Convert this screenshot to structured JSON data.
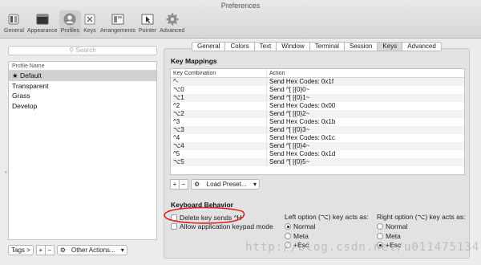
{
  "window": {
    "title": "Preferences"
  },
  "toolbar": {
    "items": [
      {
        "label": "General",
        "icon": "switch-icon"
      },
      {
        "label": "Appearance",
        "icon": "window-icon"
      },
      {
        "label": "Profiles",
        "icon": "person-icon"
      },
      {
        "label": "Keys",
        "icon": "keys-icon"
      },
      {
        "label": "Arrangements",
        "icon": "arrangements-icon"
      },
      {
        "label": "Pointer",
        "icon": "pointer-icon"
      },
      {
        "label": "Advanced",
        "icon": "gear-icon"
      }
    ],
    "active": "Profiles"
  },
  "search": {
    "placeholder": "Search"
  },
  "profile_list": {
    "header": "Profile Name",
    "rows": [
      "★ Default",
      "Transparent",
      "Grass",
      "Develop"
    ]
  },
  "bottom": {
    "tags_label": "Tags >",
    "plus": "+",
    "minus": "−",
    "other_actions": "Other Actions..."
  },
  "tabs": {
    "items": [
      "General",
      "Colors",
      "Text",
      "Window",
      "Terminal",
      "Session",
      "Keys",
      "Advanced"
    ],
    "active": "Keys"
  },
  "key_mappings": {
    "title": "Key Mappings",
    "columns": [
      "Key Combination",
      "Action"
    ],
    "rows": [
      [
        "^-",
        "Send Hex Codes: 0x1f"
      ],
      [
        "⌥0",
        "Send ^[ [{0}0~"
      ],
      [
        "⌥1",
        "Send ^[ [{0}1~"
      ],
      [
        "^2",
        "Send Hex Codes: 0x00"
      ],
      [
        "⌥2",
        "Send ^[ [{0}2~"
      ],
      [
        "^3",
        "Send Hex Codes: 0x1b"
      ],
      [
        "⌥3",
        "Send ^[ [{0}3~"
      ],
      [
        "^4",
        "Send Hex Codes: 0x1c"
      ],
      [
        "⌥4",
        "Send ^[ [{0}4~"
      ],
      [
        "^5",
        "Send Hex Codes: 0x1d"
      ],
      [
        "⌥5",
        "Send ^[ [{0}5~"
      ]
    ],
    "plus": "+",
    "minus": "−",
    "load_preset": "Load Preset..."
  },
  "keyboard_behavior": {
    "title": "Keyboard Behavior",
    "delete_sends_h": "Delete key sends ^H",
    "keypad_mode": "Allow application keypad mode",
    "left_option": {
      "label": "Left option (⌥) key acts as:",
      "options": [
        "Normal",
        "Meta",
        "+Esc"
      ],
      "selected": "Normal"
    },
    "right_option": {
      "label": "Right option (⌥) key acts as:",
      "options": [
        "Normal",
        "Meta",
        "+Esc"
      ],
      "selected": "+Esc"
    }
  },
  "watermark": "http://blog.csdn.net/u011475134",
  "colors": {
    "annotation": "#e02020",
    "selection": "#d0d0d0"
  }
}
